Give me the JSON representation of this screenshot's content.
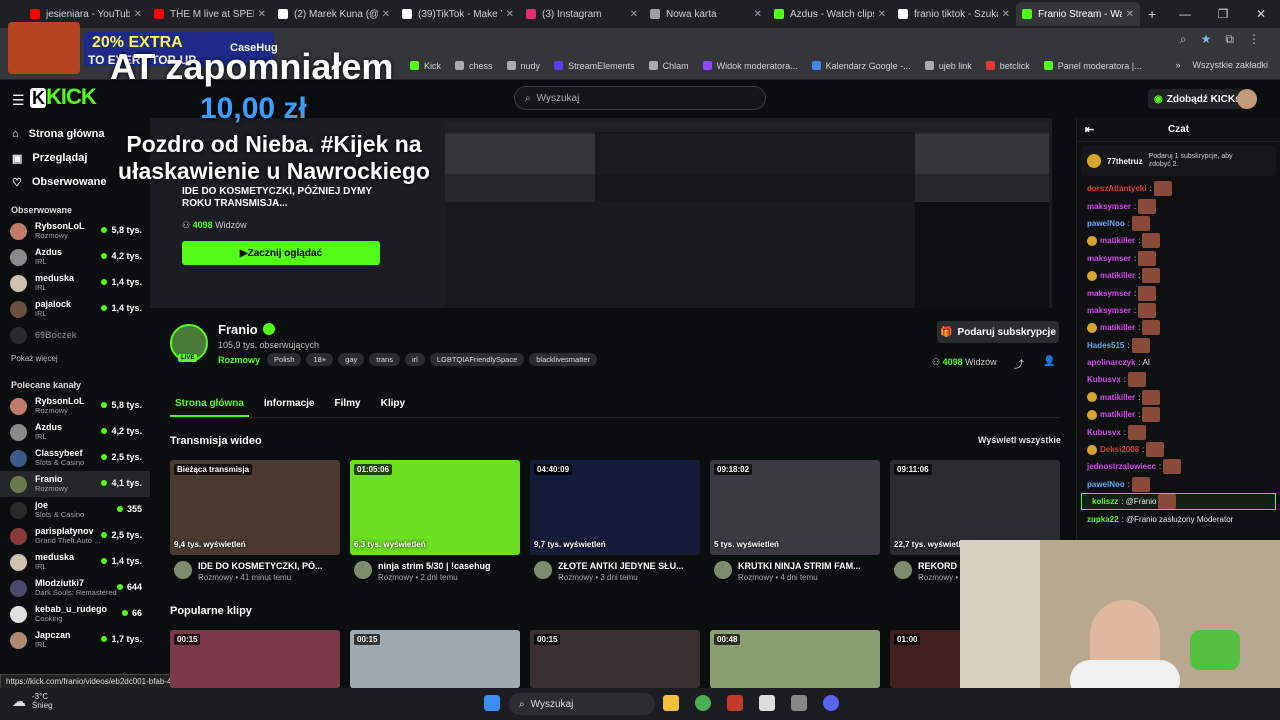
{
  "browser": {
    "tabs": [
      {
        "label": "jesieniara - YouTube",
        "color": "#ff0000"
      },
      {
        "label": "THE M live at SPEEDI",
        "color": "#ff0000"
      },
      {
        "label": "(2) Marek Kuna (@M",
        "color": "#ffffff"
      },
      {
        "label": "(39)TikTok - Make Yo",
        "color": "#ffffff"
      },
      {
        "label": "(3) Instagram",
        "color": "#e1306c"
      },
      {
        "label": "Nowa karta",
        "color": "#9aa0a6"
      },
      {
        "label": "Azdus - Watch clips o",
        "color": "#53fc18"
      },
      {
        "label": "franio tiktok - Szukaj",
        "color": "#ffffff"
      },
      {
        "label": "Franio Stream - Watc",
        "color": "#53fc18"
      }
    ],
    "new_tab": "+",
    "bookmarks": [
      {
        "label": "Kick",
        "color": "#53fc18"
      },
      {
        "label": "chess",
        "color": "#aaaaaa"
      },
      {
        "label": "nudy",
        "color": "#aaaaaa"
      },
      {
        "label": "StreamElements",
        "color": "#5b3cf5"
      },
      {
        "label": "Chlam",
        "color": "#aaaaaa"
      },
      {
        "label": "Widok moderatora...",
        "color": "#9146ff"
      },
      {
        "label": "Kalendarz Google -...",
        "color": "#4285f4"
      },
      {
        "label": "ujeb link",
        "color": "#aaaaaa"
      },
      {
        "label": "betclick",
        "color": "#e53935"
      },
      {
        "label": "Panel moderatora |...",
        "color": "#53fc18"
      }
    ],
    "bookmarks_all": "Wszystkie zakładki"
  },
  "overlay": {
    "promo_big": "20% EXTRA",
    "promo_small": "TO EVERY TOP-UP",
    "promo_brand": "CaseHug",
    "donation_name": "AT zapomniałem",
    "donation_amount": "10,00 zł",
    "donation_message": "Pozdro od Nieba. #Kijek na ułaskawienie u Nawrockiego"
  },
  "site": {
    "logo_letters": "KICK",
    "search_placeholder": "Wyszukaj",
    "kicks_button": "Zdobądź KICKs"
  },
  "sidebar": {
    "nav": [
      {
        "label": "Strona główna",
        "icon": "home-icon"
      },
      {
        "label": "Przeglądaj",
        "icon": "browse-icon"
      },
      {
        "label": "Obserwowane",
        "icon": "heart-icon"
      }
    ],
    "followed_title": "Obserwowane",
    "followed": [
      {
        "name": "RybsonLoL",
        "cat": "Rozmowy",
        "viewers": "5,8 tys.",
        "color": "#c47a6a"
      },
      {
        "name": "Azdus",
        "cat": "IRL",
        "viewers": "4,2 tys.",
        "color": "#8a8a8a"
      },
      {
        "name": "meduska",
        "cat": "IRL",
        "viewers": "1,4 tys.",
        "color": "#d0c0b0"
      },
      {
        "name": "pajalock",
        "cat": "IRL",
        "viewers": "1,4 tys.",
        "color": "#6a5040"
      },
      {
        "name": "69Boczek",
        "cat": "",
        "viewers": "",
        "color": "#555555"
      }
    ],
    "show_more": "Pokaż więcej",
    "recommended_title": "Polecane kanały",
    "recommended": [
      {
        "name": "RybsonLoL",
        "cat": "Rozmowy",
        "viewers": "5,8 tys.",
        "color": "#c47a6a"
      },
      {
        "name": "Azdus",
        "cat": "IRL",
        "viewers": "4,2 tys.",
        "color": "#8a8a8a"
      },
      {
        "name": "Classybeef",
        "cat": "Slots & Casino",
        "viewers": "2,5 tys.",
        "color": "#3a5a8a"
      },
      {
        "name": "Franio",
        "cat": "Rozmowy",
        "viewers": "4,1 tys.",
        "color": "#6a7a50"
      },
      {
        "name": "joe",
        "cat": "Slots & Casino",
        "viewers": "355",
        "color": "#2a2a2a"
      },
      {
        "name": "parisplatynov",
        "cat": "Grand Theft Auto ...",
        "viewers": "2,5 tys.",
        "color": "#8a3a3a"
      },
      {
        "name": "meduska",
        "cat": "IRL",
        "viewers": "1,4 tys.",
        "color": "#d0c0b0"
      },
      {
        "name": "Mlodziutki7",
        "cat": "Dark Souls: Remastered",
        "viewers": "644",
        "color": "#4a4a6a"
      },
      {
        "name": "kebab_u_rudego",
        "cat": "Cooking",
        "viewers": "66",
        "color": "#e0e0e0"
      },
      {
        "name": "Japczan",
        "cat": "IRL",
        "viewers": "1,7 tys.",
        "color": "#b08a70"
      }
    ],
    "status_url": "https://kick.com/franio/videos/eb2dc001-bfab-471a-bba2-c7a921363ccb"
  },
  "player": {
    "title": "IDE DO KOSMETYCZKI, PÓŹNIEJ DYMY ROKU TRANSMISJA...",
    "viewers": "4098",
    "viewers_label": "Widzów",
    "watch_button": "Zacznij oglądać"
  },
  "channel": {
    "name": "Franio",
    "followers": "105,9 tys. obserwujących",
    "category": "Rozmowy",
    "tags": [
      "Polish",
      "18+",
      "gay",
      "trans",
      "irl",
      "LGBTQIAFriendlySpace",
      "blacklivesmatter"
    ],
    "live": "LIVE",
    "subscribe_button": "Podaruj subskrypcje",
    "viewers": "4098",
    "viewers_label": "Widzów"
  },
  "tabs": [
    "Strona główna",
    "Informacje",
    "Filmy",
    "Klipy"
  ],
  "videos_section": {
    "title": "Transmisja wideo",
    "see_all": "Wyświetl wszystkie",
    "items": [
      {
        "badge": "Bieżąca transmisja",
        "views": "9,4 tys. wyświetleń",
        "title": "IDE DO KOSMETYCZKI, PÓ...",
        "meta": "Rozmowy • 41 minut temu",
        "color": "#4a3a30"
      },
      {
        "badge": "01:05:06",
        "views": "6,3 tys. wyświetleń",
        "title": "ninja strim 5/30 | !casehug",
        "meta": "Rozmowy • 2 dni temu",
        "color": "#6ae020"
      },
      {
        "badge": "04:40:09",
        "views": "9,7 tys. wyświetleń",
        "title": "ZŁOTE ANTKI JEDYNE SŁU...",
        "meta": "Rozmowy • 3 dni temu",
        "color": "#141c3a"
      },
      {
        "badge": "09:18:02",
        "views": "5 tys. wyświetleń",
        "title": "KRUTKI NINJA STRIM FAM...",
        "meta": "Rozmowy • 4 dni temu",
        "color": "#3a3a40"
      },
      {
        "badge": "09:11:06",
        "views": "22,7 tys. wyświetleń",
        "title": "REKORD ŚWI...",
        "meta": "Rozmowy • 5 dni temu",
        "color": "#2a2d30"
      }
    ]
  },
  "clips_section": {
    "title": "Popularne klipy",
    "items": [
      {
        "dur": "00:15",
        "color": "#7a3a4a"
      },
      {
        "dur": "00:15",
        "color": "#a0a8b0"
      },
      {
        "dur": "00:15",
        "color": "#3a3030"
      },
      {
        "dur": "00:48",
        "color": "#8aa070"
      },
      {
        "dur": "01:00",
        "color": "#402020"
      }
    ]
  },
  "chat": {
    "title": "Czat",
    "pinned_user": "77thetruz",
    "pinned_text": "Podaruj 1 subskrypcje, aby zdobyć 2.",
    "messages": [
      {
        "user": "dorszAtlantycki",
        "text": ":",
        "color": "#e53935",
        "badge": false
      },
      {
        "user": "maksymser",
        "text": ":",
        "color": "#d946ef",
        "badge": false
      },
      {
        "user": "pawelNoo",
        "text": ":",
        "color": "#60a5fa",
        "badge": false
      },
      {
        "user": "matikiller",
        "text": ":",
        "color": "#d946ef",
        "badge": true
      },
      {
        "user": "maksymser",
        "text": ":",
        "color": "#d946ef",
        "badge": false
      },
      {
        "user": "matikiller",
        "text": ":",
        "color": "#d946ef",
        "badge": true
      },
      {
        "user": "maksymser",
        "text": ":",
        "color": "#d946ef",
        "badge": false
      },
      {
        "user": "maksymser",
        "text": ":",
        "color": "#d946ef",
        "badge": false
      },
      {
        "user": "matikiller",
        "text": ":",
        "color": "#d946ef",
        "badge": true
      },
      {
        "user": "Hades515",
        "text": ":",
        "color": "#60a5fa",
        "badge": false
      },
      {
        "user": "apolinarczyk",
        "text": ": AI",
        "color": "#d946ef",
        "badge": false
      },
      {
        "user": "Kubusvx",
        "text": ":",
        "color": "#d946ef",
        "badge": false
      },
      {
        "user": "matikiller",
        "text": ":",
        "color": "#d946ef",
        "badge": true
      },
      {
        "user": "matikiller",
        "text": ":",
        "color": "#d946ef",
        "badge": true
      },
      {
        "user": "Kubusvx",
        "text": ":",
        "color": "#d946ef",
        "badge": false
      },
      {
        "user": "Deksi2008",
        "text": ":",
        "color": "#e53935",
        "badge": true
      },
      {
        "user": "jednostrzalowiecc",
        "text": ":",
        "color": "#d946ef",
        "badge": false
      },
      {
        "user": "pawelNoo",
        "text": ":",
        "color": "#60a5fa",
        "badge": false
      },
      {
        "user": "koliszz",
        "text": ": @Franio",
        "color": "#53fc18",
        "badge": false
      },
      {
        "user": "zupka22",
        "text": ": @Franio zasłużony Moderator",
        "color": "#53fc18",
        "badge": false
      }
    ]
  },
  "taskbar": {
    "temp": "-3°C",
    "weather": "Śnieg",
    "search": "Wyszukaj"
  }
}
